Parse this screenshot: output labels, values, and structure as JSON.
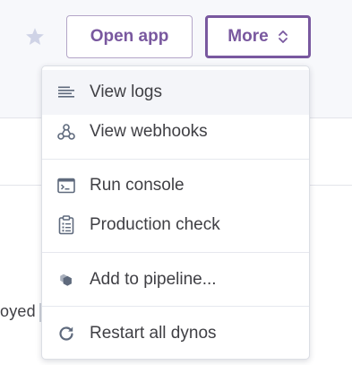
{
  "header": {
    "open_app_label": "Open app",
    "more_label": "More"
  },
  "background": {
    "fragment_text": "oyed"
  },
  "menu": {
    "items": [
      {
        "label": "View logs",
        "icon": "logs-icon"
      },
      {
        "label": "View webhooks",
        "icon": "webhooks-icon"
      },
      {
        "label": "Run console",
        "icon": "console-icon"
      },
      {
        "label": "Production check",
        "icon": "clipboard-check-icon"
      },
      {
        "label": "Add to pipeline...",
        "icon": "pipeline-icon"
      },
      {
        "label": "Restart all dynos",
        "icon": "restart-icon"
      }
    ]
  },
  "colors": {
    "accent": "#79589f",
    "icon_gray": "#5f6a7d",
    "text": "#3f3f44",
    "hover_bg": "#f4f5f9"
  }
}
